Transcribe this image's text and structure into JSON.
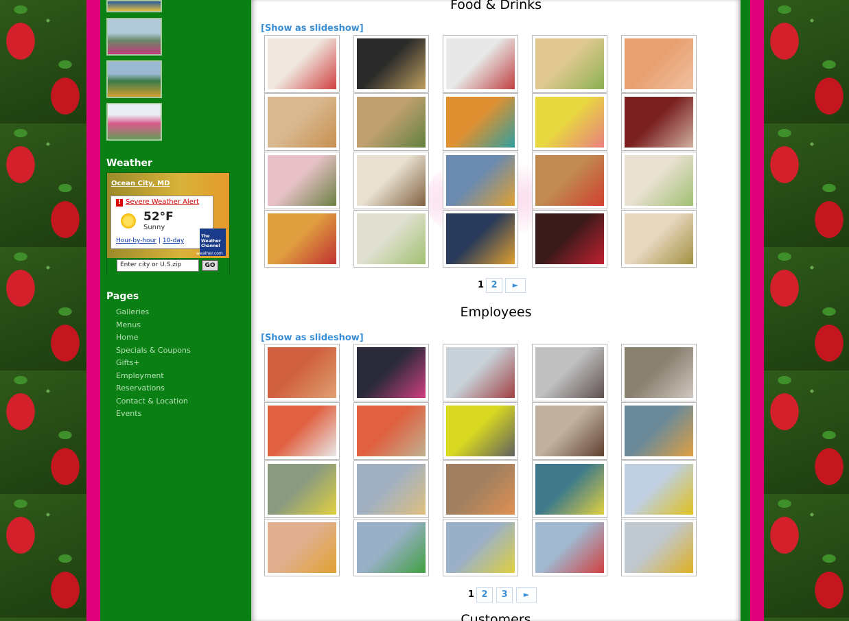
{
  "sidebar": {
    "weather_heading": "Weather",
    "pages_heading": "Pages",
    "pages": [
      "Galleries",
      "Menus",
      "Home",
      "Specials & Coupons",
      "Gifts+",
      "Employment",
      "Reservations",
      "Contact & Location",
      "Events"
    ]
  },
  "weather_widget": {
    "city": "Ocean City, MD",
    "alert_icon": "!",
    "alert": "Severe Weather Alert",
    "temperature": "52°F",
    "condition": "Sunny",
    "link_hourly": "Hour-by-hour",
    "link_separator": "|",
    "link_10day": "10-day",
    "logo_text": "The Weather Channel",
    "logo_url": "weather.com",
    "input_placeholder": "Enter city or U.S.zip",
    "go_label": "GO"
  },
  "sections": {
    "food": {
      "title": "Food & Drinks",
      "slideshow": "[Show as slideshow]",
      "pager": {
        "current": "1",
        "pages": [
          "2"
        ],
        "next": "►"
      }
    },
    "employees": {
      "title": "Employees",
      "slideshow": "[Show as slideshow]",
      "pager": {
        "current": "1",
        "pages": [
          "2",
          "3"
        ],
        "next": "►"
      }
    },
    "customers": {
      "title": "Customers"
    }
  },
  "colors": {
    "pink": "#e0007c",
    "green": "#0a8014",
    "link_blue": "#3a8fd6"
  }
}
